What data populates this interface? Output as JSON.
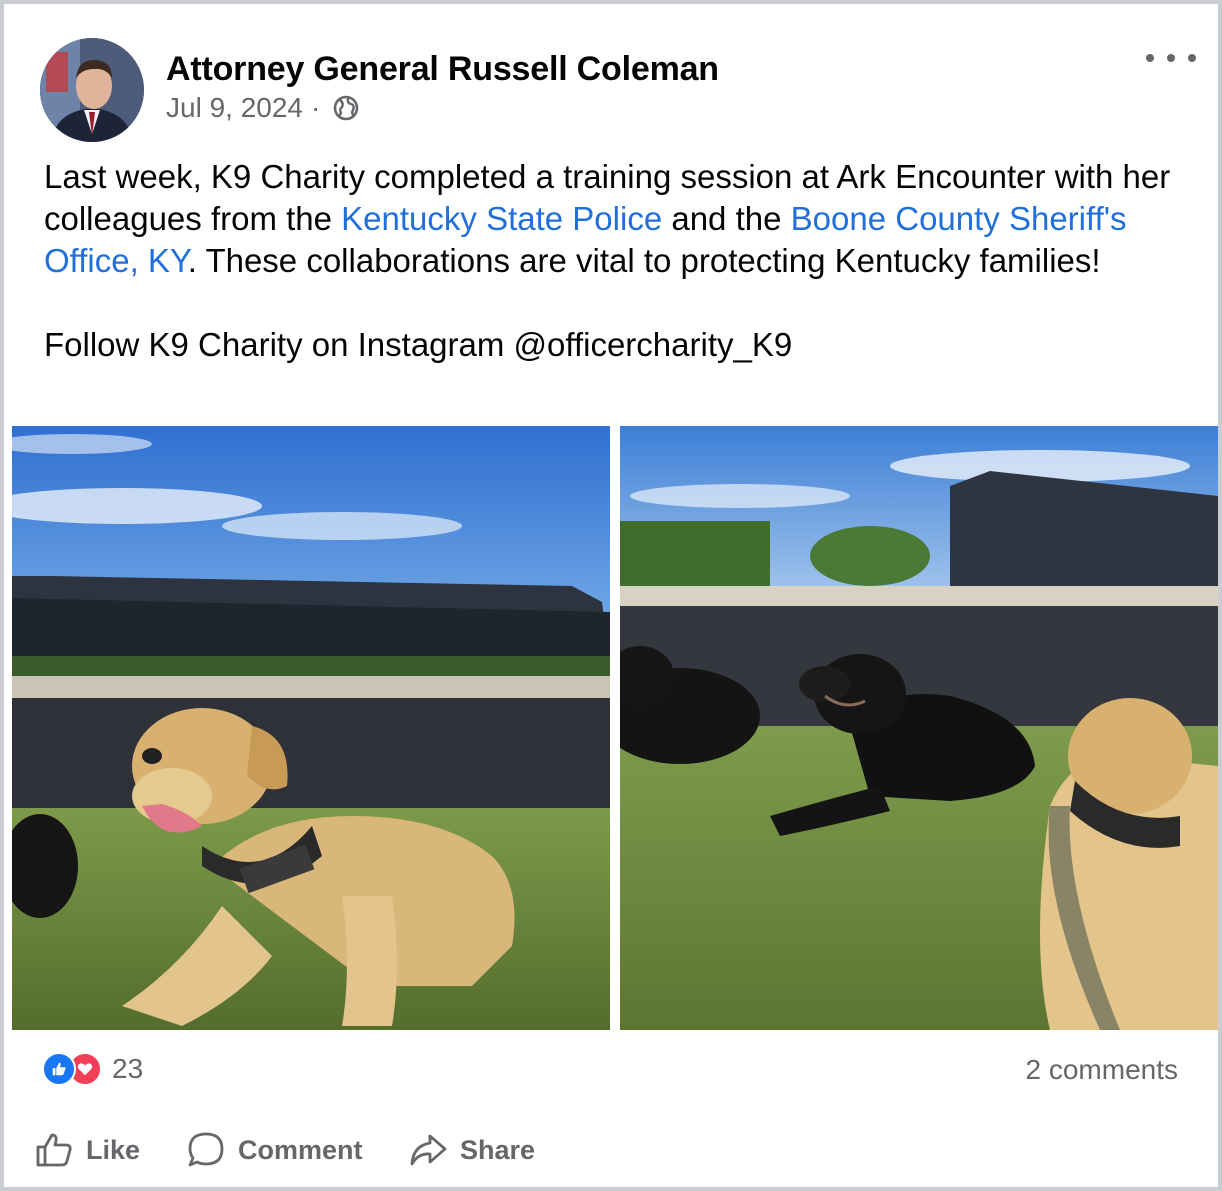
{
  "post": {
    "author": "Attorney General Russell Coleman",
    "date": "Jul 9, 2024",
    "separator": "·",
    "privacy_icon": "globe-icon",
    "more_icon": "more-options-icon",
    "text": {
      "part1": "Last week, K9 Charity completed a training session at Ark Encounter with her colleagues from the ",
      "link1": "Kentucky State Police",
      "part2": " and the ",
      "link2": "Boone County Sheriff's Office, KY",
      "part3": ". These collaborations are vital to protecting Kentucky families!",
      "paragraph2": "Follow K9 Charity on Instagram @officercharity_K9"
    },
    "link_color": "#216fdb"
  },
  "engagement": {
    "reaction_icons": [
      "like-reaction-icon",
      "love-reaction-icon"
    ],
    "reaction_count": "23",
    "comments": "2 comments"
  },
  "actions": {
    "like": "Like",
    "comment": "Comment",
    "share": "Share"
  }
}
